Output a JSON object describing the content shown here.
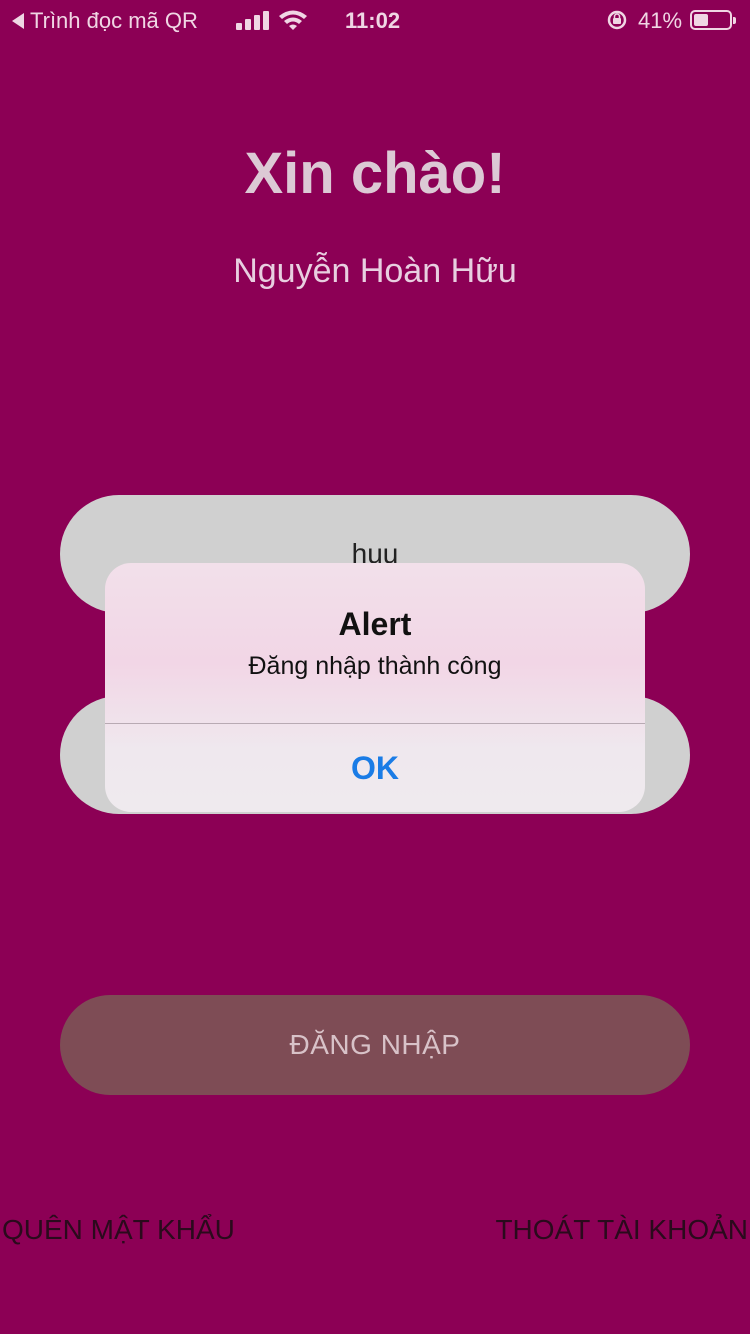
{
  "status_bar": {
    "back_label": "Trình đọc mã QR",
    "time": "11:02",
    "battery_percent": "41%",
    "battery_level": 0.41,
    "icons": [
      "back-caret-icon",
      "cellular-signal-icon",
      "wifi-icon",
      "rotation-lock-icon",
      "battery-icon"
    ]
  },
  "greeting": "Xin chào!",
  "user_name": "Nguyễn Hoàn Hữu",
  "form": {
    "username_value": "huu",
    "password_value": ""
  },
  "login_button": "ĐĂNG NHẬP",
  "links": {
    "forgot_password": "QUÊN MẬT KHẨU",
    "logout": "THOÁT TÀI KHOẢN"
  },
  "alert": {
    "title": "Alert",
    "message": "Đăng nhập thành công",
    "ok_label": "OK"
  },
  "colors": {
    "background": "#8c0055",
    "field": "#d0d0d0",
    "button": "#7e4c55",
    "alert_action": "#1a7ce6"
  }
}
